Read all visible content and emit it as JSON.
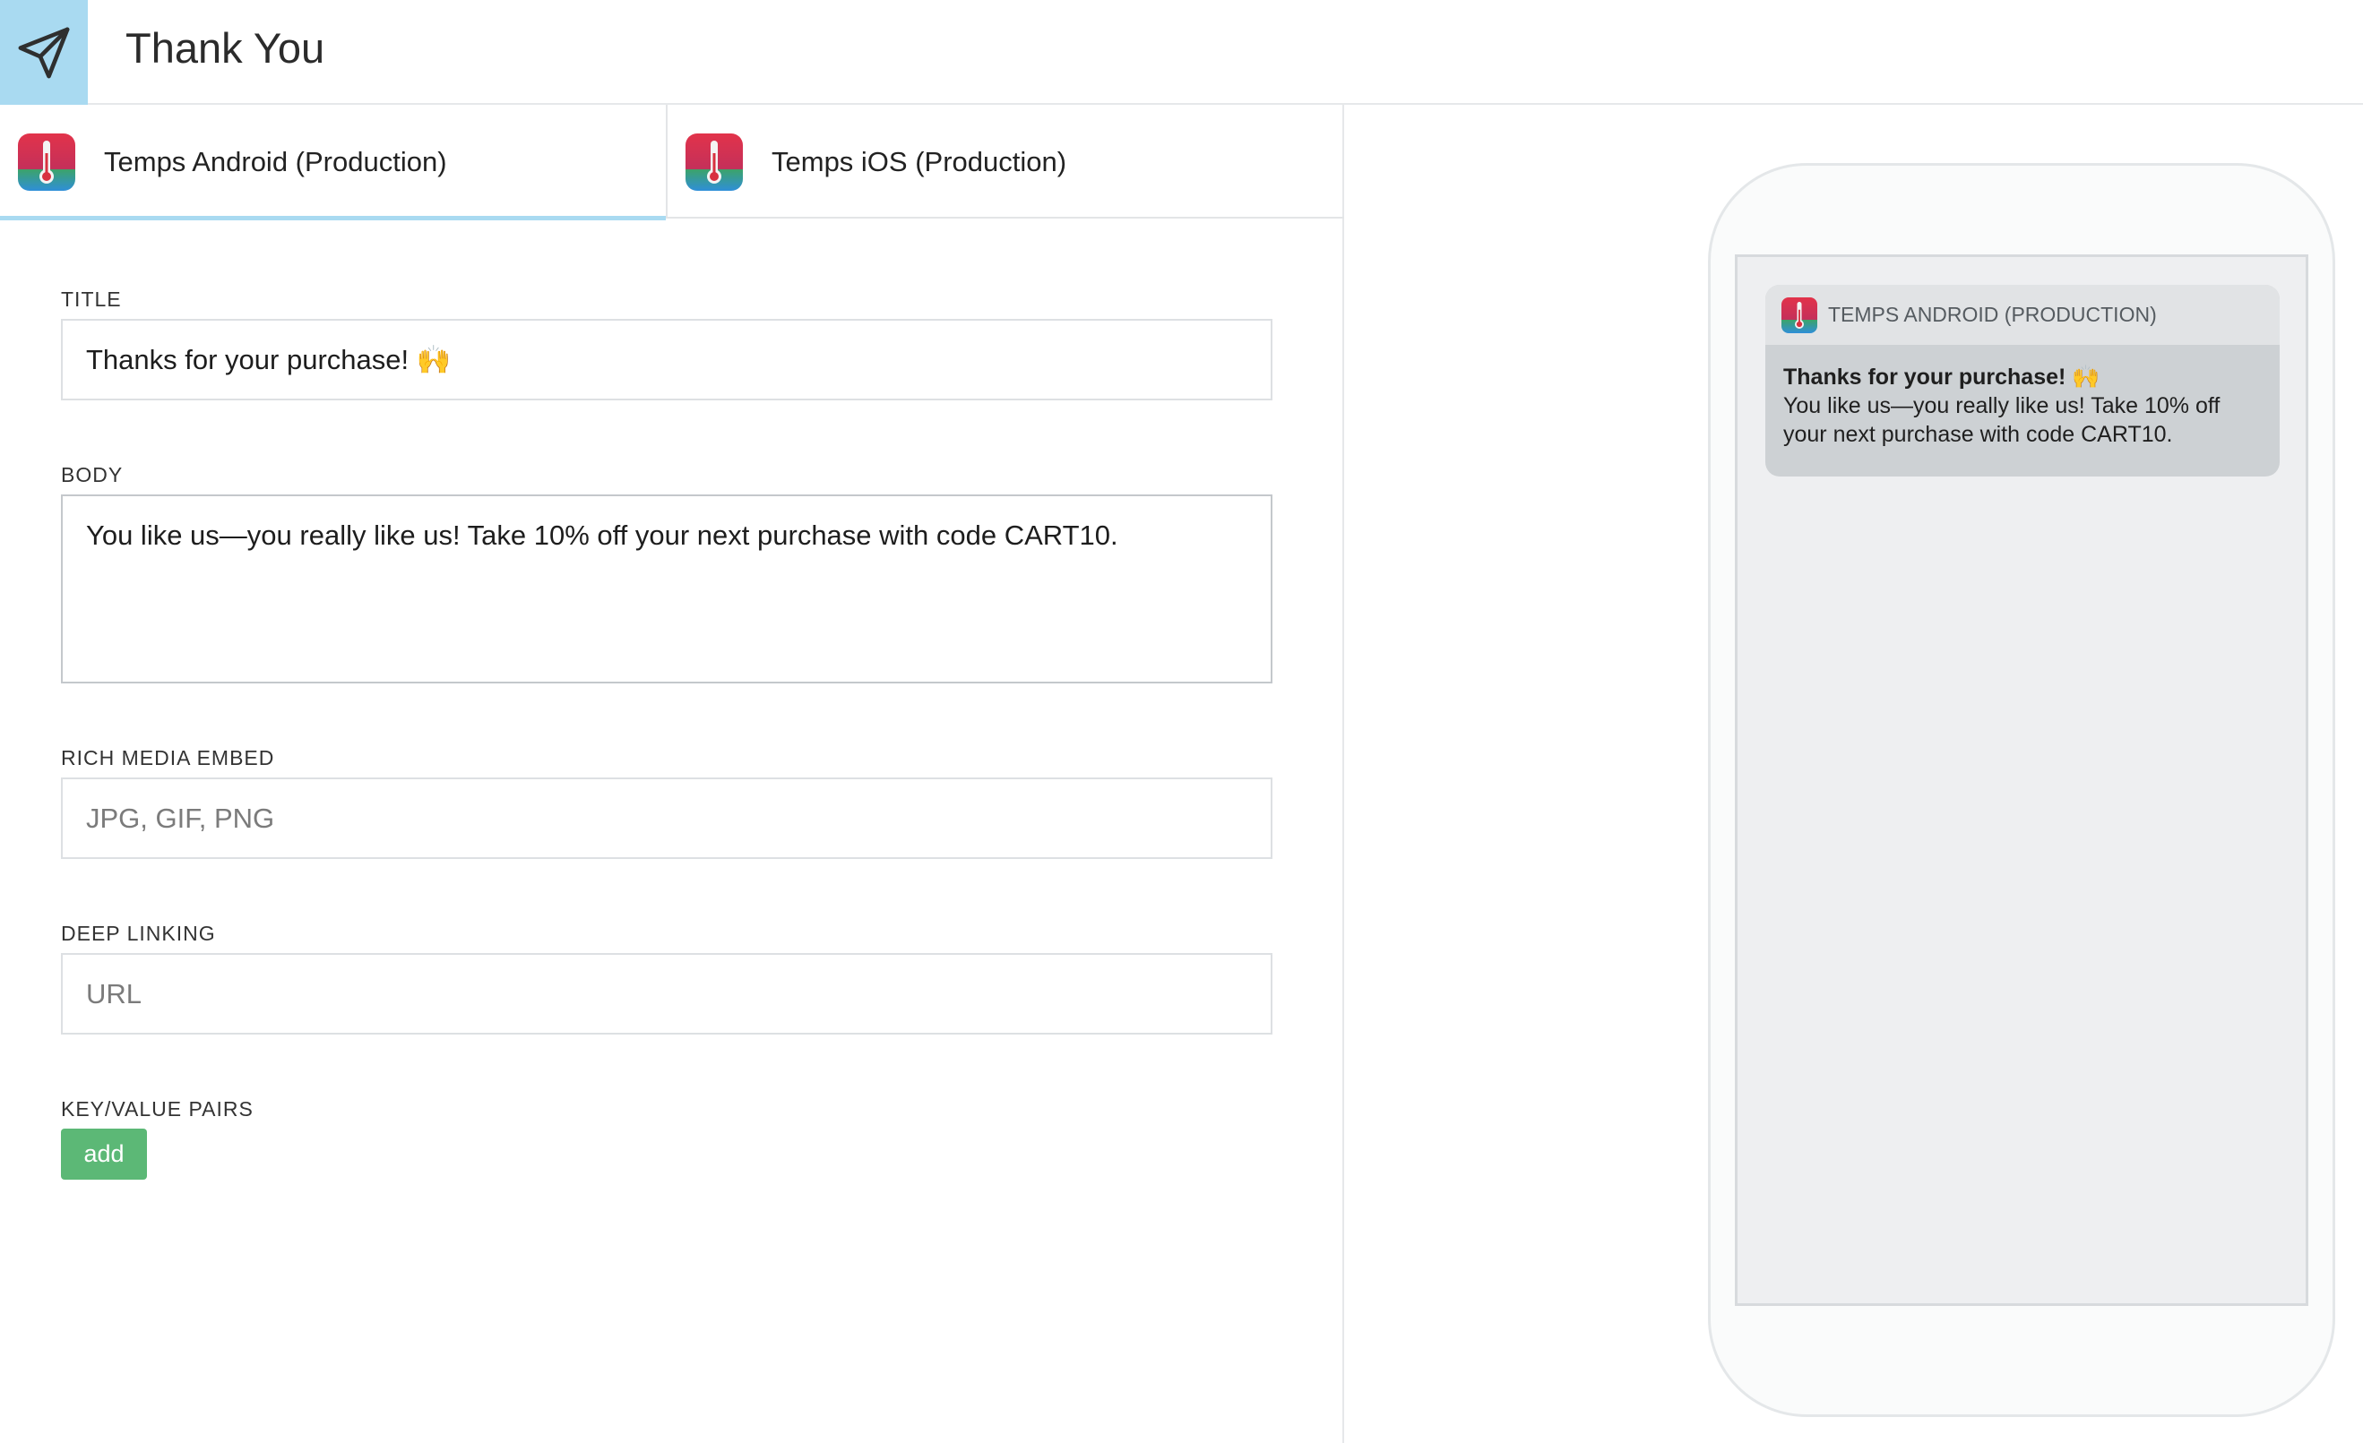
{
  "header": {
    "title": "Thank You",
    "icon": "paper-plane-icon"
  },
  "tabs": [
    {
      "label": "Temps Android (Production)",
      "active": true,
      "icon": "thermometer-app-icon"
    },
    {
      "label": "Temps iOS (Production)",
      "active": false,
      "icon": "thermometer-app-icon"
    }
  ],
  "form": {
    "title_label": "TITLE",
    "title_value": "Thanks for your purchase! 🙌",
    "body_label": "BODY",
    "body_value": "You like us—you really like us! Take 10% off your next purchase with code CART10.",
    "media_label": "RICH MEDIA EMBED",
    "media_placeholder": "JPG, GIF, PNG",
    "deeplink_label": "DEEP LINKING",
    "deeplink_placeholder": "URL",
    "kv_label": "KEY/VALUE PAIRS",
    "add_label": "add"
  },
  "preview": {
    "app_name": "TEMPS ANDROID (PRODUCTION)",
    "title": "Thanks for your purchase! 🙌",
    "body": "You like us—you really like us! Take 10% off your next purchase with code CART10."
  },
  "colors": {
    "accent": "#a9daf1",
    "add_button": "#5cb876"
  }
}
